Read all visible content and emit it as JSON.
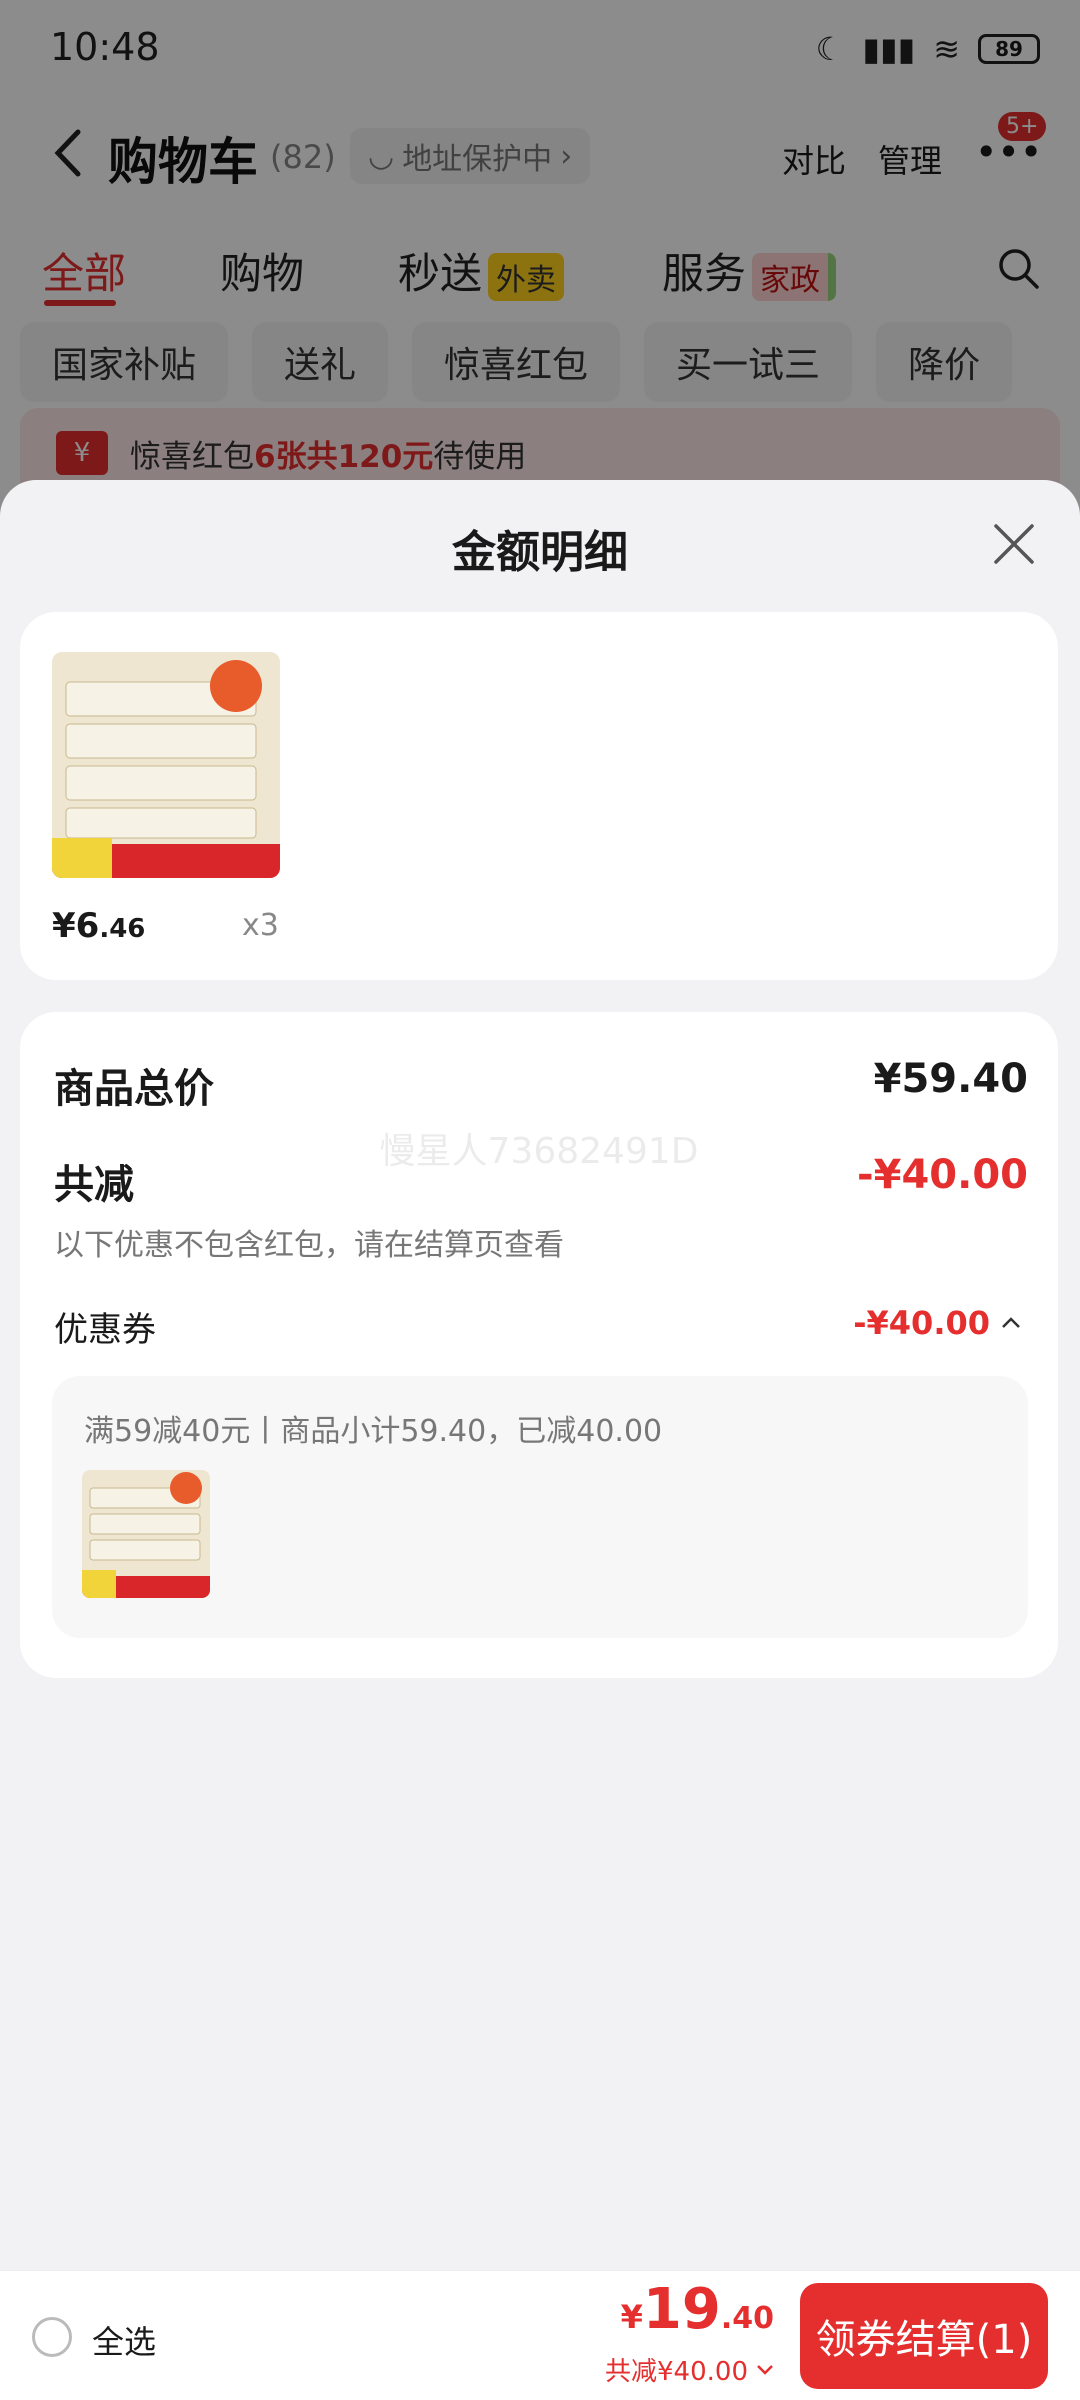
{
  "status": {
    "time": "10:48",
    "battery": "89"
  },
  "header": {
    "title": "购物车",
    "count": "(82)",
    "address_protect": "地址保护中",
    "compare": "对比",
    "manage": "管理",
    "more_badge": "5+"
  },
  "tabs": [
    {
      "label": "全部",
      "tag": ""
    },
    {
      "label": "购物",
      "tag": ""
    },
    {
      "label": "秒送",
      "tag": "外卖"
    },
    {
      "label": "服务",
      "tag": "家政"
    }
  ],
  "chips": [
    "国家补贴",
    "送礼",
    "惊喜红包",
    "买一试三",
    "降价"
  ],
  "notice": {
    "prefix": "惊喜红包",
    "highlight": "6张共120元",
    "suffix": "待使用"
  },
  "sheet": {
    "title": "金额明细",
    "item": {
      "price_int": "¥6",
      "price_dec": ".46",
      "qty": "x3"
    },
    "total_label": "商品总价",
    "total_value": "¥59.40",
    "discount_label": "共减",
    "discount_value": "-¥40.00",
    "discount_note": "以下优惠不包含红包，请在结算页查看",
    "coupon_label": "优惠券",
    "coupon_value": "-¥40.00",
    "coupon_detail": "满59减40元丨商品小计59.40，已减40.00",
    "watermark": "慢星人73682491D"
  },
  "bottom": {
    "select_all": "全选",
    "currency": "¥",
    "total_int": "19",
    "total_dec": ".40",
    "saved": "共减¥40.00",
    "checkout": "领券结算(1)"
  },
  "colors": {
    "accent": "#e52e2e",
    "sheet_bg": "#f2f2f4"
  },
  "icons": [
    "back-icon",
    "search-icon",
    "close-icon",
    "chevron-up-icon",
    "chevron-down-icon",
    "coupon-icon",
    "more-icon"
  ]
}
